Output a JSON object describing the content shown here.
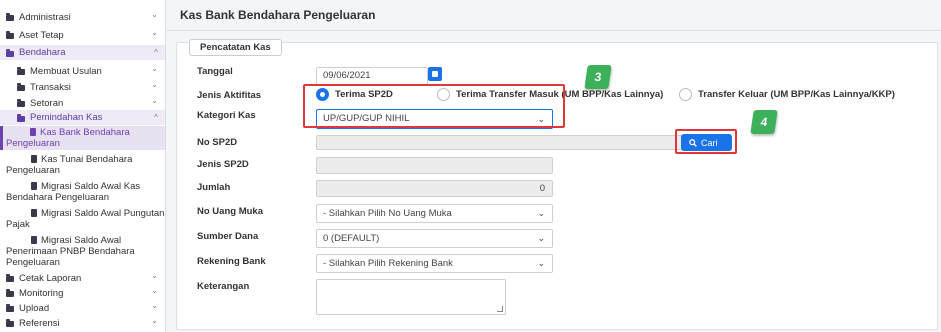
{
  "sidebar": {
    "items": [
      {
        "label": "Administrasi"
      },
      {
        "label": "Aset Tetap"
      },
      {
        "label": "Bendahara"
      },
      {
        "label": "Membuat Usulan"
      },
      {
        "label": "Transaksi"
      },
      {
        "label": "Setoran"
      },
      {
        "label": "Pemindahan Kas"
      },
      {
        "label1": "Kas Bank Bendahara",
        "label2": "Pengeluaran"
      },
      {
        "label1": "Kas Tunai Bendahara",
        "label2": "Pengeluaran"
      },
      {
        "label1": "Migrasi Saldo Awal Kas",
        "label2": "Bendahara Pengeluaran"
      },
      {
        "label1": "Migrasi Saldo Awal Pungutan",
        "label2": "Pajak"
      },
      {
        "label1": "Migrasi Saldo Awal",
        "label2": "Penerimaan PNBP Bendahara",
        "label3": "Pengeluaran"
      },
      {
        "label": "Cetak Laporan"
      },
      {
        "label": "Monitoring"
      },
      {
        "label": "Upload"
      },
      {
        "label": "Referensi"
      }
    ],
    "chev_down": "⌄",
    "chev_up": "^"
  },
  "page": {
    "title": "Kas Bank Bendahara Pengeluaran",
    "section_legend": "Pencatatan Kas"
  },
  "form": {
    "tanggal_label": "Tanggal",
    "tanggal_value": "09/06/2021",
    "jenis_aktifitas_label": "Jenis Aktifitas",
    "radio_terima_sp2d": "Terima SP2D",
    "radio_terima_transfer": "Terima Transfer Masuk (UM BPP/Kas Lainnya)",
    "radio_transfer_keluar": "Transfer Keluar (UM BPP/Kas Lainnya/KKP)",
    "kategori_kas_label": "Kategori Kas",
    "kategori_kas_value": "UP/GUP/GUP NIHIL",
    "no_sp2d_label": "No SP2D",
    "cari_label": "Cari",
    "jenis_sp2d_label": "Jenis SP2D",
    "jumlah_label": "Jumlah",
    "jumlah_value": "0",
    "no_uang_muka_label": "No Uang Muka",
    "no_uang_muka_value": "- Silahkan Pilih No Uang Muka",
    "sumber_dana_label": "Sumber Dana",
    "sumber_dana_value": "0 (DEFAULT)",
    "rekening_bank_label": "Rekening Bank",
    "rekening_bank_value": "- Silahkan Pilih Rekening Bank",
    "keterangan_label": "Keterangan"
  },
  "annotations": {
    "badge3": "3",
    "badge4": "4"
  },
  "colors": {
    "accent": "#1a73e8",
    "sidebar_active": "#6b44b0",
    "highlight": "#e0373a",
    "badge": "#3db05a"
  }
}
